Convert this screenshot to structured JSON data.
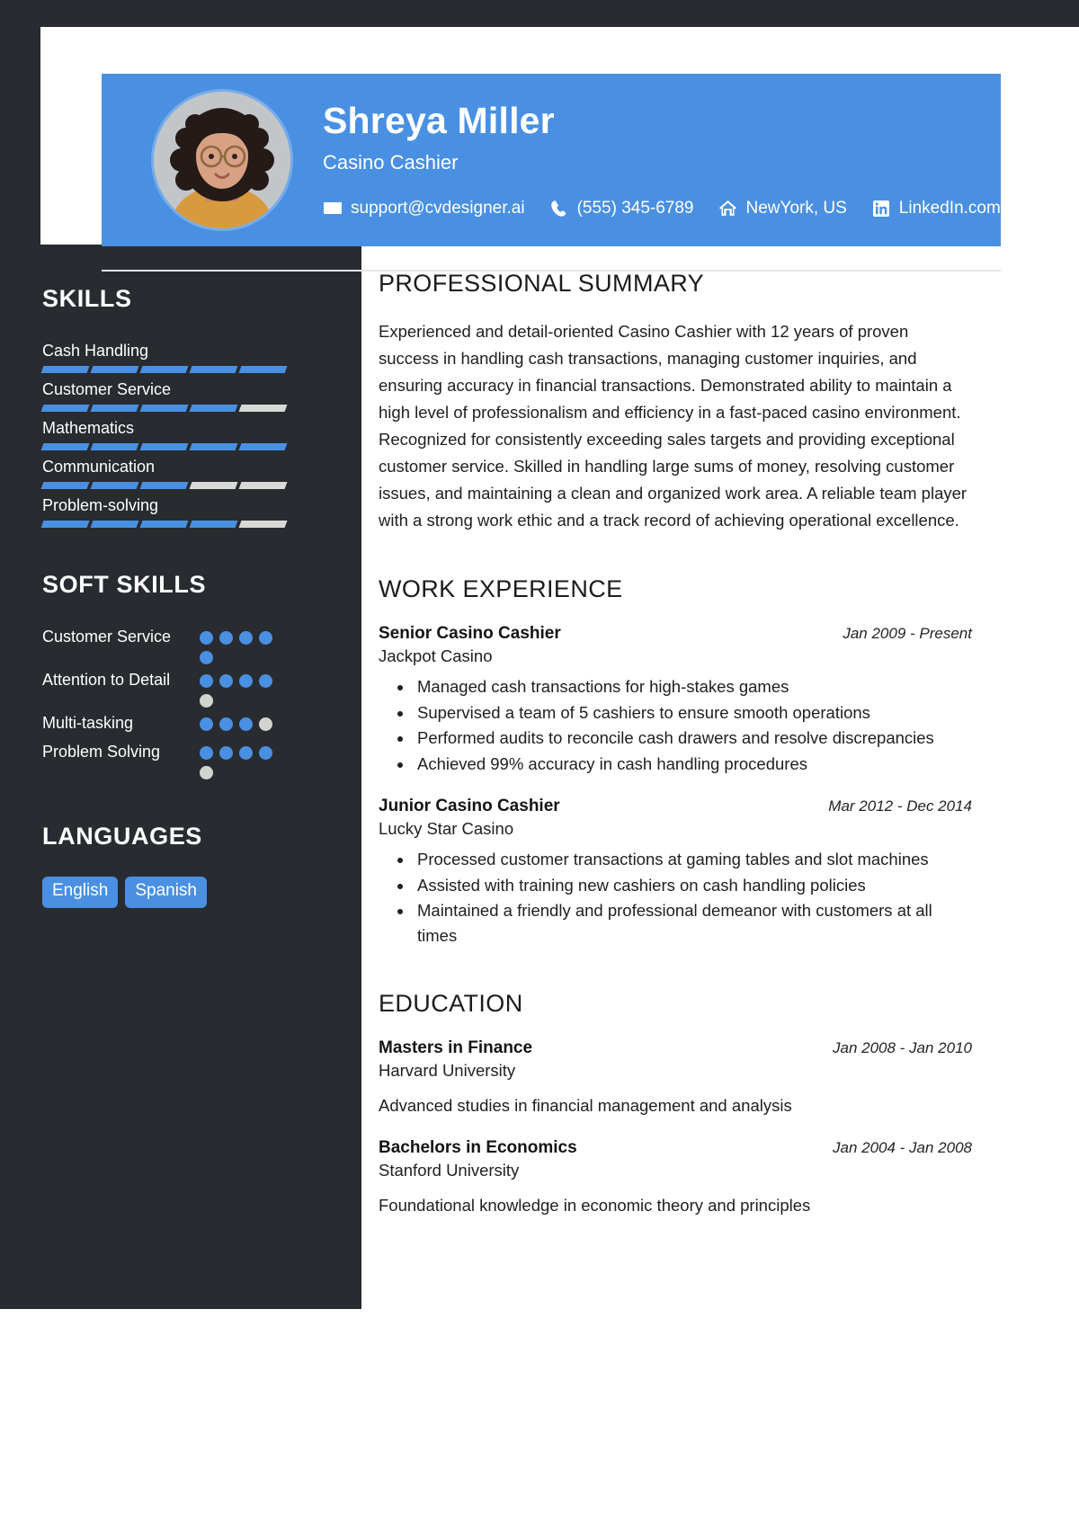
{
  "header": {
    "name": "Shreya Miller",
    "job_title": "Casino Cashier",
    "avatar_alt": "profile-photo",
    "contacts": [
      {
        "icon": "envelope-icon",
        "text": "support@cvdesigner.ai"
      },
      {
        "icon": "phone-icon",
        "text": "(555) 345-6789"
      },
      {
        "icon": "home-icon",
        "text": "NewYork, US"
      },
      {
        "icon": "linkedin-icon",
        "text": "LinkedIn.com"
      }
    ]
  },
  "sidebar": {
    "skills_heading": "SKILLS",
    "skills": [
      {
        "name": "Cash Handling",
        "level": 5,
        "max": 5
      },
      {
        "name": "Customer Service",
        "level": 4,
        "max": 5
      },
      {
        "name": "Mathematics",
        "level": 5,
        "max": 5
      },
      {
        "name": "Communication",
        "level": 3,
        "max": 5
      },
      {
        "name": "Problem-solving",
        "level": 4,
        "max": 5
      }
    ],
    "soft_skills_heading": "SOFT SKILLS",
    "soft_skills": [
      {
        "name": "Customer Service",
        "level": 5,
        "max": 5
      },
      {
        "name": "Attention to Detail",
        "level": 4,
        "max": 5
      },
      {
        "name": "Multi-tasking",
        "level": 3,
        "max": 4
      },
      {
        "name": "Problem Solving",
        "level": 4,
        "max": 5
      }
    ],
    "languages_heading": "LANGUAGES",
    "languages": [
      "English",
      "Spanish"
    ]
  },
  "main": {
    "summary_heading": "PROFESSIONAL SUMMARY",
    "summary_text": "Experienced and detail-oriented Casino Cashier with 12 years of proven success in handling cash transactions, managing customer inquiries, and ensuring accuracy in financial transactions. Demonstrated ability to maintain a high level of professionalism and efficiency in a fast-paced casino environment. Recognized for consistently exceeding sales targets and providing exceptional customer service. Skilled in handling large sums of money, resolving customer issues, and maintaining a clean and organized work area. A reliable team player with a strong work ethic and a track record of achieving operational excellence.",
    "experience_heading": "WORK EXPERIENCE",
    "experience": [
      {
        "title": "Senior Casino Cashier",
        "date": "Jan 2009 - Present",
        "organization": "Jackpot Casino",
        "bullets": [
          "Managed cash transactions for high-stakes games",
          "Supervised a team of 5 cashiers to ensure smooth operations",
          "Performed audits to reconcile cash drawers and resolve discrepancies",
          "Achieved 99% accuracy in cash handling procedures"
        ]
      },
      {
        "title": "Junior Casino Cashier",
        "date": "Mar 2012 - Dec 2014",
        "organization": "Lucky Star Casino",
        "bullets": [
          "Processed customer transactions at gaming tables and slot machines",
          "Assisted with training new cashiers on cash handling policies",
          "Maintained a friendly and professional demeanor with customers at all times"
        ]
      }
    ],
    "education_heading": "EDUCATION",
    "education": [
      {
        "degree": "Masters in Finance",
        "date": "Jan 2008 - Jan 2010",
        "school": "Harvard University",
        "description": "Advanced studies in financial management and analysis"
      },
      {
        "degree": "Bachelors in Economics",
        "date": "Jan 2004 - Jan 2008",
        "school": "Stanford University",
        "description": "Foundational knowledge in economic theory and principles"
      }
    ]
  },
  "colors": {
    "accent": "#4a90e2",
    "sidebar_bg": "#282b30",
    "bar_empty": "#d9d9d6",
    "text_dark": "#1b1b1b"
  }
}
